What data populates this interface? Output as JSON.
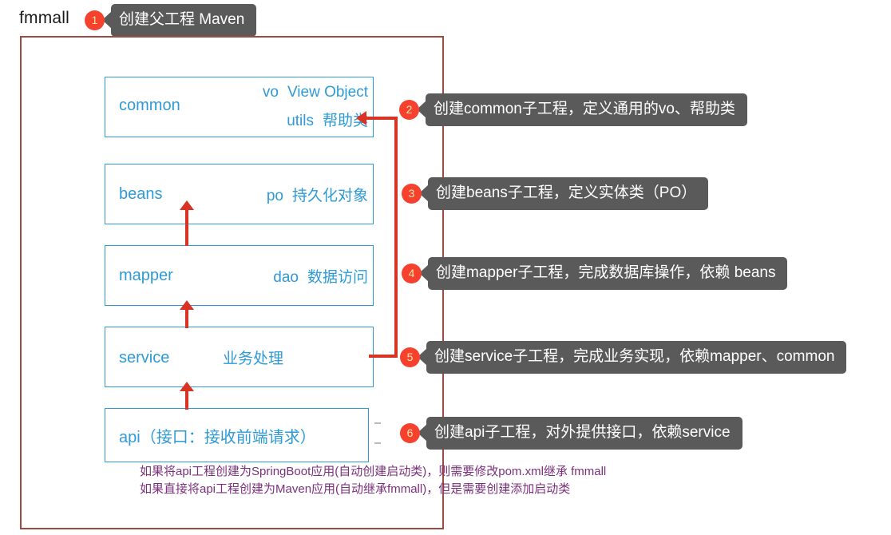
{
  "diagram": {
    "root_project": "fmmall",
    "modules": [
      {
        "key": "common",
        "name": "common",
        "rows": [
          {
            "abbr": "vo",
            "desc": "View Object"
          },
          {
            "abbr": "utils",
            "desc": "帮助类"
          }
        ]
      },
      {
        "key": "beans",
        "name": "beans",
        "rows": [
          {
            "abbr": "po",
            "desc": "持久化对象"
          }
        ]
      },
      {
        "key": "mapper",
        "name": "mapper",
        "rows": [
          {
            "abbr": "dao",
            "desc": "数据访问"
          }
        ]
      },
      {
        "key": "service",
        "name": "service",
        "rows": [
          {
            "abbr": "",
            "desc": "业务处理"
          }
        ]
      }
    ],
    "api_module": "api（接口：接收前端请求）",
    "steps": [
      {
        "number": "1",
        "text": "创建父工程  Maven"
      },
      {
        "number": "2",
        "text": "创建common子工程，定义通用的vo、帮助类"
      },
      {
        "number": "3",
        "text": "创建beans子工程，定义实体类（PO）"
      },
      {
        "number": "4",
        "text": "创建mapper子工程，完成数据库操作，依赖 beans"
      },
      {
        "number": "5",
        "text": "创建service子工程，完成业务实现，依赖mapper、common"
      },
      {
        "number": "6",
        "text": "创建api子工程，对外提供接口，依赖service"
      }
    ],
    "notes": [
      "如果将api工程创建为SpringBoot应用(自动创建启动类)，则需要修改pom.xml继承 fmmall",
      "如果直接将api工程创建为Maven应用(自动继承fmmall)，但是需要创建添加启动类"
    ],
    "colors": {
      "module_border": "#2e9bd6",
      "module_text": "#2e9bd6",
      "outer_border": "#9c4b42",
      "arrow": "#d93423",
      "badge": "#f5412d",
      "bubble": "#5a5a5a",
      "notes": "#7b2f7b"
    }
  }
}
